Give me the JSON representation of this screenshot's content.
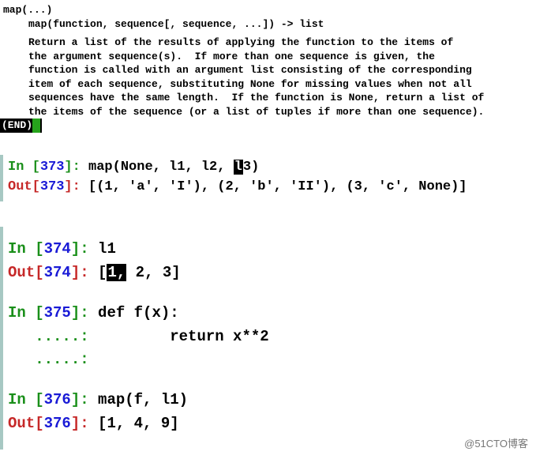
{
  "doc": {
    "signature": "map(...)",
    "proto": "map(function, sequence[, sequence, ...]) -> list",
    "para": "Return a list of the results of applying the function to the items of\nthe argument sequence(s).  If more than one sequence is given, the\nfunction is called with an argument list consisting of the corresponding\nitem of each sequence, substituting None for missing values when not all\nsequences have the same length.  If the function is None, return a list of\nthe items of the sequence (or a list of tuples if more than one sequence).",
    "end": "(END)"
  },
  "cells": {
    "c373": {
      "in_label": "In [",
      "in_num": "373",
      "in_close": "]: ",
      "in_code": "map(None, l1, l2, l3)",
      "out_label": "Out[",
      "out_num": "373",
      "out_close": "]: ",
      "out_val": "[(1, 'a', 'I'), (2, 'b', 'II'), (3, 'c', None)]"
    },
    "c374": {
      "in_label": "In [",
      "in_num": "374",
      "in_close": "]: ",
      "in_code": "l1",
      "out_label": "Out[",
      "out_num": "374",
      "out_close": "]: ",
      "out_val": "[1, 2, 3]"
    },
    "c375": {
      "in_label": "In [",
      "in_num": "375",
      "in_close": "]: ",
      "line1": "def f(x):",
      "cont": "   .....:",
      "line2": "         return x**2"
    },
    "c376": {
      "in_label": "In [",
      "in_num": "376",
      "in_close": "]: ",
      "in_code": "map(f, l1)",
      "out_label": "Out[",
      "out_num": "376",
      "out_close": "]: ",
      "out_val": "[1, 4, 9]"
    }
  },
  "watermark": "@51CTO博客"
}
